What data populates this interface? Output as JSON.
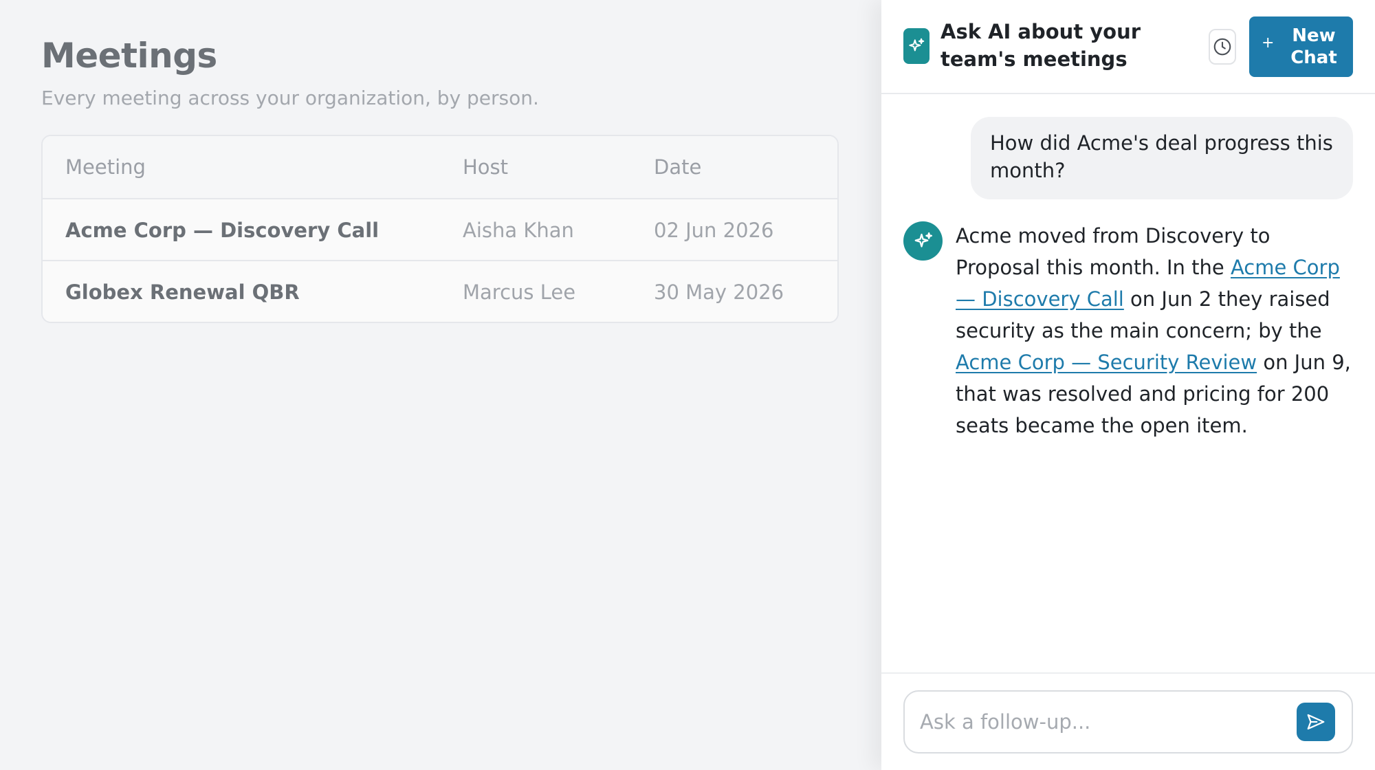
{
  "meetings": {
    "title": "Meetings",
    "subtitle": "Every meeting across your organization, by person.",
    "columns": {
      "meeting": "Meeting",
      "host": "Host",
      "date": "Date"
    },
    "rows": [
      {
        "meeting": "Acme Corp — Discovery Call",
        "host": "Aisha Khan",
        "date": "02 Jun 2026"
      },
      {
        "meeting": "Globex Renewal QBR",
        "host": "Marcus Lee",
        "date": "30 May 2026"
      }
    ]
  },
  "chat": {
    "title": "Ask AI about your team's meetings",
    "new_chat_label": "New Chat",
    "new_chat_icon": "plus-icon",
    "history_icon": "clock-icon",
    "brand_icon": "sparkle-icon",
    "user_message": "How did Acme's deal progress this month?",
    "ai_message": {
      "part1": "Acme moved from Discovery to Proposal this month. In the ",
      "link1": "Acme Corp — Discovery Call",
      "part2": " on Jun 2 they raised security as the main concern; by the ",
      "link2": "Acme Corp — Security Review",
      "part3": " on Jun 9, that was resolved and pricing for 200 seats became the open item."
    },
    "composer_placeholder": "Ask a follow-up...",
    "send_icon": "send-icon"
  },
  "colors": {
    "accent": "#1e7bab",
    "ai_teal": "#1b8f93",
    "background": "#f3f4f6"
  }
}
